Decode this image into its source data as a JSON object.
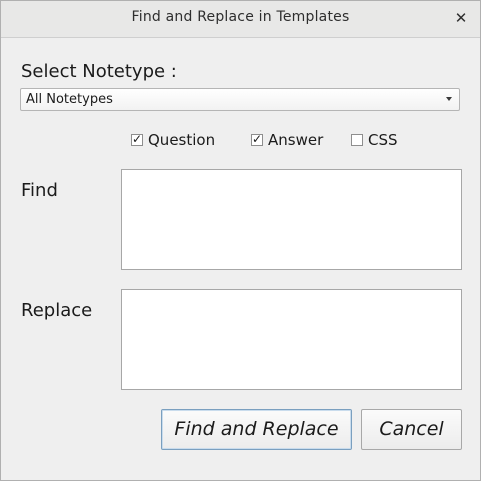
{
  "dialog": {
    "title": "Find and Replace in Templates",
    "close_icon": "close-icon"
  },
  "notetype": {
    "label": "Select Notetype :",
    "selected": "All Notetypes"
  },
  "options": {
    "question": {
      "label": "Question",
      "checked": true
    },
    "answer": {
      "label": "Answer",
      "checked": true
    },
    "css": {
      "label": "CSS",
      "checked": false
    }
  },
  "find": {
    "label": "Find",
    "value": ""
  },
  "replace": {
    "label": "Replace",
    "value": ""
  },
  "buttons": {
    "find_replace": "Find and Replace",
    "cancel": "Cancel"
  }
}
